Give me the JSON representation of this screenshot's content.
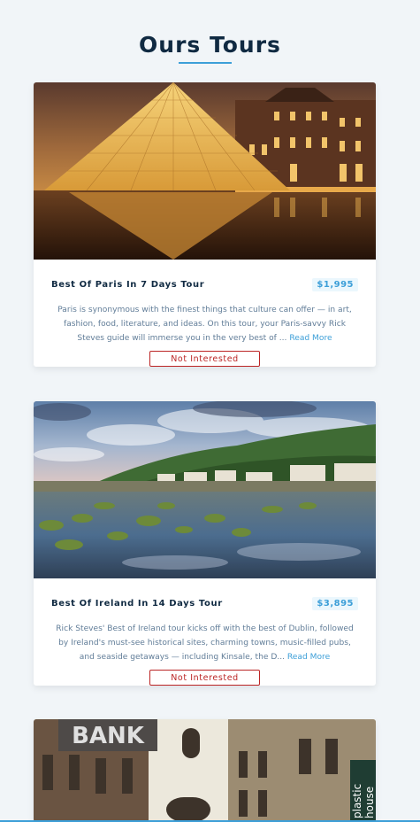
{
  "page": {
    "title": "Ours Tours"
  },
  "tours": [
    {
      "name": "Best Of Paris In 7 Days Tour",
      "price": "$1,995",
      "description": "Paris is synonymous with the finest things that culture can offer — in art, fashion, food, literature, and ideas. On this tour, your Paris-savvy Rick Steves guide will immerse you in the very best of ... ",
      "read_more": "Read More",
      "button_label": "Not Interested",
      "image": "louvre-pyramid-night"
    },
    {
      "name": "Best Of Ireland In 14 Days Tour",
      "price": "$3,895",
      "description": "Rick Steves' Best of Ireland tour kicks off with the best of Dublin, followed by Ireland's must-see historical sites, charming towns, music-filled pubs, and seaside getaways — including Kinsale, the D... ",
      "read_more": "Read More",
      "button_label": "Not Interested",
      "image": "irish-coast-town"
    },
    {
      "image": "vienna-street-bank",
      "sign_bank": "BANK",
      "sign_plastic": "plastic",
      "sign_house": "house"
    }
  ],
  "colors": {
    "primary": "#3d9fd8",
    "danger": "#bb2525",
    "background": "#f1f5f8"
  }
}
